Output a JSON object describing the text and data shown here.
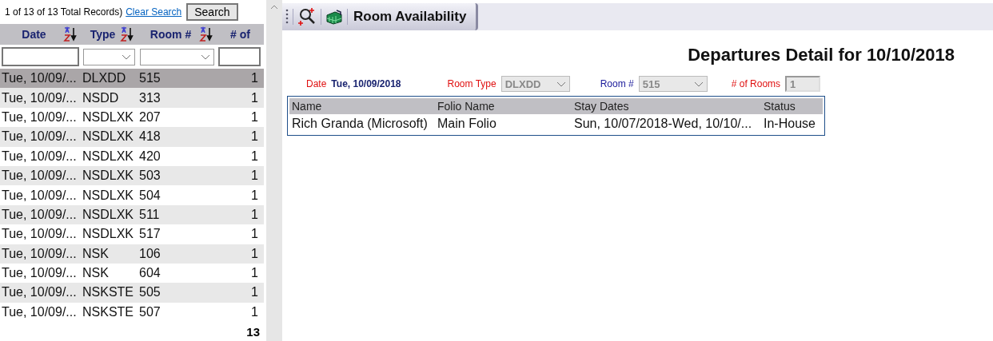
{
  "list_panel": {
    "record_count": "1 of 13 of 13 Total Records)",
    "clear_search_link": "Clear Search",
    "search_button": "Search",
    "columns": [
      {
        "label": "Date",
        "sortable": true
      },
      {
        "label": "Type",
        "sortable": true
      },
      {
        "label": "Room #",
        "sortable": true
      },
      {
        "label": "# of",
        "sortable": false
      }
    ],
    "filters": [
      {
        "kind": "text"
      },
      {
        "kind": "select"
      },
      {
        "kind": "select"
      },
      {
        "kind": "text"
      }
    ],
    "rows": [
      {
        "date": "Tue, 10/09/...",
        "type": "DLXDD",
        "room": "515",
        "count": "1",
        "selected": true
      },
      {
        "date": "Tue, 10/09/...",
        "type": "NSDD",
        "room": "313",
        "count": "1",
        "selected": false
      },
      {
        "date": "Tue, 10/09/...",
        "type": "NSDLXK",
        "room": "207",
        "count": "1",
        "selected": false
      },
      {
        "date": "Tue, 10/09/...",
        "type": "NSDLXK",
        "room": "418",
        "count": "1",
        "selected": false
      },
      {
        "date": "Tue, 10/09/...",
        "type": "NSDLXK",
        "room": "420",
        "count": "1",
        "selected": false
      },
      {
        "date": "Tue, 10/09/...",
        "type": "NSDLXK",
        "room": "503",
        "count": "1",
        "selected": false
      },
      {
        "date": "Tue, 10/09/...",
        "type": "NSDLXK",
        "room": "504",
        "count": "1",
        "selected": false
      },
      {
        "date": "Tue, 10/09/...",
        "type": "NSDLXK",
        "room": "511",
        "count": "1",
        "selected": false
      },
      {
        "date": "Tue, 10/09/...",
        "type": "NSDLXK",
        "room": "517",
        "count": "1",
        "selected": false
      },
      {
        "date": "Tue, 10/09/...",
        "type": "NSK",
        "room": "106",
        "count": "1",
        "selected": false
      },
      {
        "date": "Tue, 10/09/...",
        "type": "NSK",
        "room": "604",
        "count": "1",
        "selected": false
      },
      {
        "date": "Tue, 10/09/...",
        "type": "NSKSTE",
        "room": "505",
        "count": "1",
        "selected": false
      },
      {
        "date": "Tue, 10/09/...",
        "type": "NSKSTE",
        "room": "507",
        "count": "1",
        "selected": false
      }
    ],
    "total": "13"
  },
  "toolbar": {
    "button": "Room Availability"
  },
  "detail": {
    "title": "Departures Detail for 10/10/2018",
    "date_label": "Date",
    "date_value": "Tue, 10/09/2018",
    "room_type_label": "Room Type",
    "room_type_value": "DLXDD",
    "room_label": "Room #",
    "room_value": "515",
    "rooms_label": "# of Rooms",
    "rooms_value": "1",
    "table": {
      "columns": [
        "Name",
        "Folio Name",
        "Stay Dates",
        "Status"
      ],
      "rows": [
        [
          "Rich Granda (Microsoft)",
          "Main Folio",
          "Sun, 10/07/2018-Wed, 10/10/...",
          "In-House"
        ]
      ]
    }
  }
}
